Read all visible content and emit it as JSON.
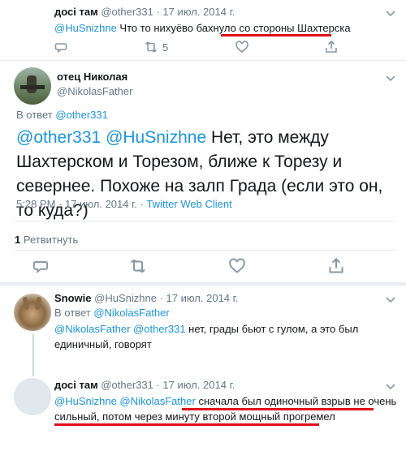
{
  "top_tweet": {
    "name": "досі там",
    "handle": "@other331",
    "date": "· 17 июл. 2014 г.",
    "mention": "@HuSnizhne",
    "text_before": " Что то нихуёво бахнуло ",
    "text_highlight": "со стороны Шахтерска",
    "retweets": "5"
  },
  "main_tweet": {
    "name": "отец Николая",
    "handle": "@NikolasFather",
    "reply_prefix": "В ответ",
    "reply_to": "@other331",
    "mention1": "@other331",
    "mention2": "@HuSnizhne",
    "text": " Нет, это между Шахтерском и Торезом, ближе к Торезу и севернее. Похоже на залп Града (если это он, то куда?)",
    "time": "5:28 PM · 17 июл. 2014 г. ·",
    "client": "Twitter Web Client",
    "retweet_count": "1",
    "retweet_label": "Ретвитнуть"
  },
  "reply1": {
    "name": "Snowie",
    "handle": "@HuSnizhne",
    "date": "· 17 июл. 2014 г.",
    "reply_prefix": "В ответ",
    "reply_to": "@NikolasFather",
    "mention1": "@NikolasFather",
    "mention2": "@other331",
    "text": " нет, грады бьют с гулом, а это был единичный, говорят"
  },
  "reply2": {
    "name": "досі там",
    "handle": "@other331",
    "date": "· 17 июл. 2014 г.",
    "mention1": "@HuSnizhne",
    "mention2": "@NikolasFather",
    "text_line1": "сначала был одиночный взрыв не очень",
    "text_line2": "сильный, потом через минуту второй мощный прогремел"
  },
  "icons": [
    "reply-icon",
    "retweet-icon",
    "like-icon",
    "share-icon",
    "chevron-down-icon"
  ],
  "colors": {
    "link": "#1b95e0",
    "muted": "#657786",
    "highlight": "#e0101a"
  }
}
